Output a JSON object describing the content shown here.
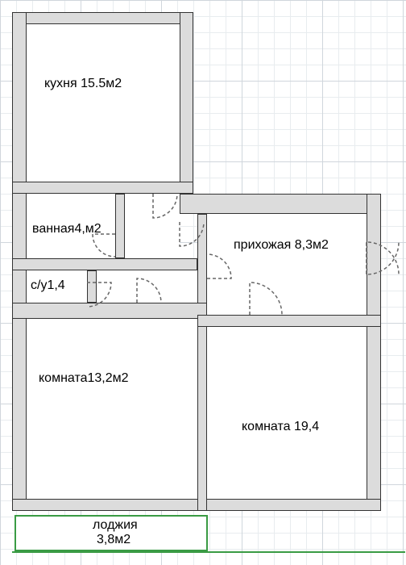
{
  "rooms": {
    "kitchen": {
      "label": "кухня 15.5м2",
      "area_m2": 15.5
    },
    "bath": {
      "label": "ванная4,м2",
      "area_m2": 4.0
    },
    "wc": {
      "label": "с/у1,4",
      "area_m2": 1.4
    },
    "hall": {
      "label": "прихожая 8,3м2",
      "area_m2": 8.3
    },
    "room1": {
      "label": "комната13,2м2",
      "area_m2": 13.2
    },
    "room2": {
      "label": "комната 19,4",
      "area_m2": 19.4
    },
    "balcony": {
      "label": "лоджия",
      "area_m2": 3.8,
      "area_label": "3,8м2"
    }
  }
}
